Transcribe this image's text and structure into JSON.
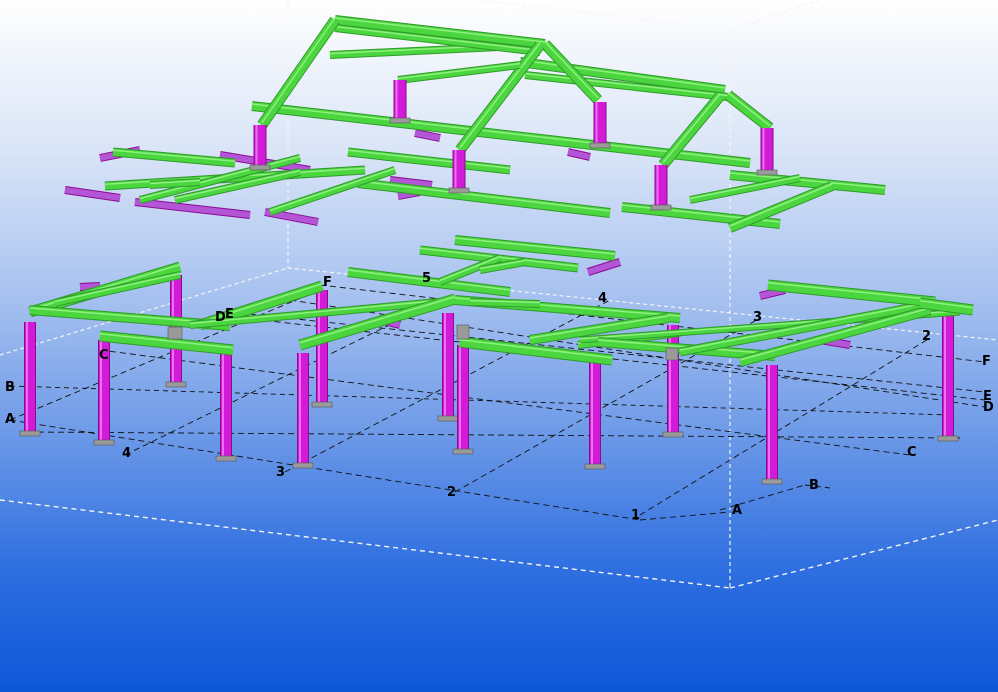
{
  "colors": {
    "beam": "#4bd63f",
    "beam_dark": "#2f9a2a",
    "column": "#d21bd6",
    "column_dark": "#8c0a90",
    "brace": "#b455d8",
    "plate": "#9a9a9a",
    "grid_line": "#111111",
    "box_line": "#eeeeee"
  },
  "grid_labels": {
    "lower_left_letters": [
      "B",
      "A",
      "C",
      "D",
      "E",
      "F"
    ],
    "lower_left_numbers": [
      "4",
      "3",
      "2",
      "1"
    ],
    "center_numbers": [
      "5",
      "4",
      "3",
      "2"
    ],
    "right_letters": [
      "F",
      "E",
      "D",
      "C",
      "B",
      "A"
    ]
  }
}
